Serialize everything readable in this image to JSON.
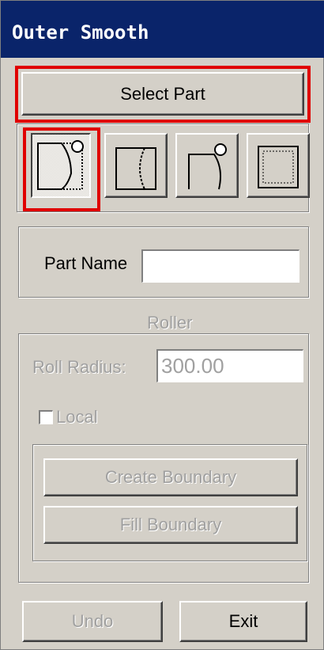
{
  "window": {
    "title": "Outer Smooth"
  },
  "select_part": {
    "label": "Select Part"
  },
  "mode_icons": [
    {
      "name": "outer-smooth-mode-icon",
      "selected": true
    },
    {
      "name": "inner-curve-mode-icon",
      "selected": false
    },
    {
      "name": "corner-circle-mode-icon",
      "selected": false
    },
    {
      "name": "square-boundary-mode-icon",
      "selected": false
    }
  ],
  "part_name": {
    "label": "Part Name",
    "value": ""
  },
  "roller": {
    "heading": "Roller",
    "radius_label": "Roll Radius:",
    "radius_value": "300.00",
    "local_label": "Local",
    "local_checked": false,
    "create_boundary_label": "Create Boundary",
    "fill_boundary_label": "Fill Boundary"
  },
  "footer": {
    "undo_label": "Undo",
    "exit_label": "Exit"
  },
  "colors": {
    "highlight": "#e00000",
    "titlebar": "#0a246a",
    "panel": "#d4d0c8"
  }
}
